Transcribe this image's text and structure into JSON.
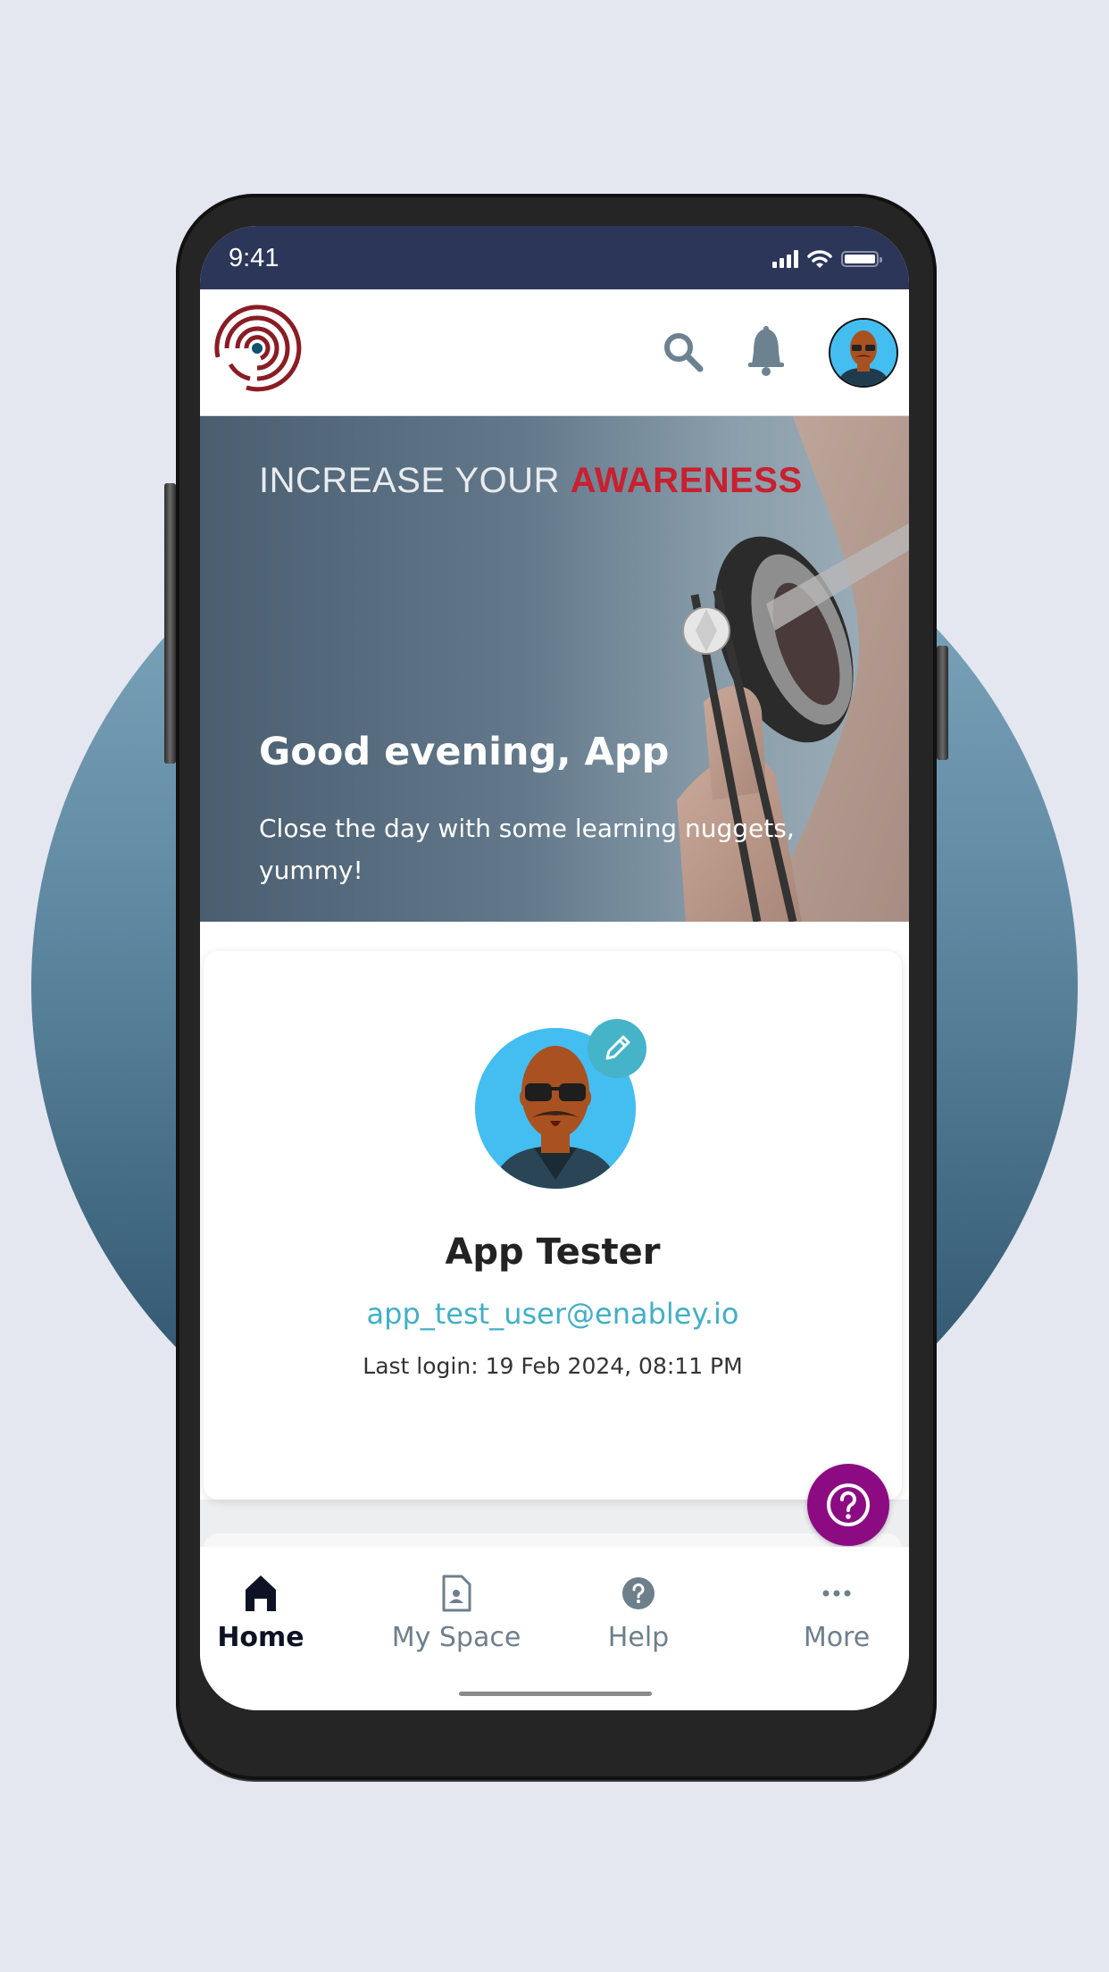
{
  "status_bar": {
    "time": "9:41"
  },
  "header": {
    "logo": "concentric-circles-logo",
    "icons": [
      "search-icon",
      "bell-icon",
      "avatar"
    ]
  },
  "banner": {
    "tagline_light": "INCREASE YOUR ",
    "tagline_bold": "AWARENESS",
    "greeting": "Good evening, App",
    "subtitle": "Close the day with some learning nuggets, yummy!"
  },
  "profile": {
    "name": "App Tester",
    "email": "app_test_user@enabley.io",
    "last_login": "Last login: 19 Feb 2024, 08:11 PM",
    "edit_icon": "pencil-icon"
  },
  "fab": {
    "icon": "help-circle-icon"
  },
  "tabs": [
    {
      "label": "Home",
      "icon": "home-icon",
      "active": true
    },
    {
      "label": "My Space",
      "icon": "document-person-icon",
      "active": false
    },
    {
      "label": "Help",
      "icon": "question-icon",
      "active": false
    },
    {
      "label": "More",
      "icon": "ellipsis-icon",
      "active": false
    }
  ],
  "colors": {
    "status_bar": "#2c3658",
    "accent_teal": "#42afc6",
    "brand_red": "#c8202f",
    "fab_purple": "#8c0b83",
    "background": "#e4e7f0"
  }
}
